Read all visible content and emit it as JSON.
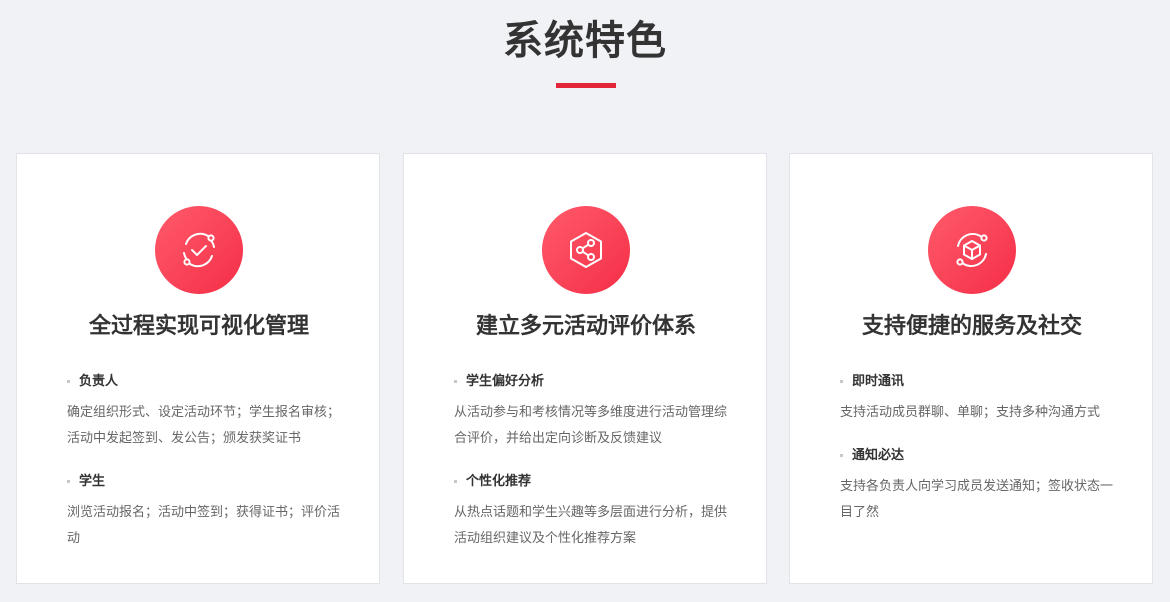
{
  "section": {
    "title": "系统特色"
  },
  "colors": {
    "accent": "#e4263a",
    "icon_gradient_start": "#ff5b6a",
    "icon_gradient_end": "#f52e48"
  },
  "cards": [
    {
      "icon": "check-cycle-icon",
      "title": "全过程实现可视化管理",
      "features": [
        {
          "title": "负责人",
          "desc": "确定组织形式、设定活动环节；学生报名审核；活动中发起签到、发公告；颁发获奖证书"
        },
        {
          "title": "学生",
          "desc": "浏览活动报名；活动中签到；获得证书；评价活动"
        }
      ]
    },
    {
      "icon": "share-hexagon-icon",
      "title": "建立多元活动评价体系",
      "features": [
        {
          "title": "学生偏好分析",
          "desc": "从活动参与和考核情况等多维度进行活动管理综合评价，并给出定向诊断及反馈建议"
        },
        {
          "title": "个性化推荐",
          "desc": "从热点话题和学生兴趣等多层面进行分析，提供活动组织建议及个性化推荐方案"
        }
      ]
    },
    {
      "icon": "cube-cycle-icon",
      "title": "支持便捷的服务及社交",
      "features": [
        {
          "title": "即时通讯",
          "desc": "支持活动成员群聊、单聊；支持多种沟通方式"
        },
        {
          "title": "通知必达",
          "desc": "支持各负责人向学习成员发送通知；签收状态一目了然"
        }
      ]
    }
  ]
}
